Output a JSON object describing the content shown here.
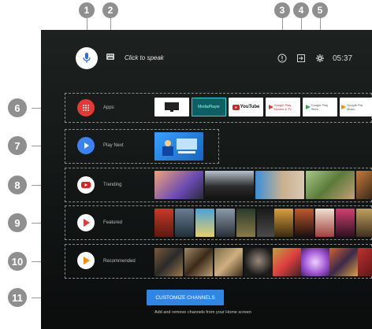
{
  "markers": [
    "1",
    "2",
    "3",
    "4",
    "5",
    "6",
    "7",
    "8",
    "9",
    "10",
    "11"
  ],
  "top_bar": {
    "voice_hint": "Click to speak",
    "time": "05:37"
  },
  "rows": [
    {
      "label": "Apps",
      "apps": [
        "",
        "MediaPlayer",
        "YouTube",
        "Google Play Movies & TV",
        "Google Play Store",
        "Google Pla Music"
      ]
    },
    {
      "label": "Play Next"
    },
    {
      "label": "Trending"
    },
    {
      "label": "Featured"
    },
    {
      "label": "Recommended"
    }
  ],
  "customize": {
    "button_label": "CUSTOMIZE CHANNELS",
    "subtitle": "Add and remove channels from your Home screen"
  },
  "colors": {
    "apps_icon": "#e53935",
    "play_next_icon": "#3b82f6",
    "trending_icon": "#ffffff",
    "button": "#2f86e5"
  }
}
